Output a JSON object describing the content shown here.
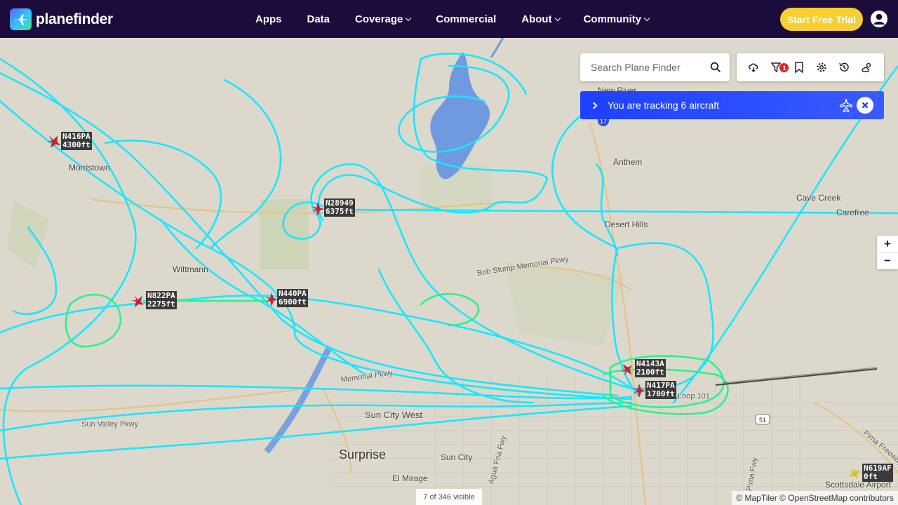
{
  "brand": {
    "name": "planefinder"
  },
  "nav": [
    {
      "label": "Apps",
      "dropdown": false
    },
    {
      "label": "Data",
      "dropdown": false
    },
    {
      "label": "Coverage",
      "dropdown": true
    },
    {
      "label": "Commercial",
      "dropdown": false
    },
    {
      "label": "About",
      "dropdown": true
    },
    {
      "label": "Community",
      "dropdown": true
    }
  ],
  "cta": {
    "label": "Start Free Trial",
    "color": "#f7cf2f"
  },
  "search": {
    "placeholder": "Search Plane Finder"
  },
  "toolbar": {
    "icons": [
      "weather-icon",
      "filter-icon",
      "bookmark-icon",
      "settings-icon",
      "history-icon",
      "cloud-sun-icon"
    ],
    "filter_badge": "1"
  },
  "tracking": {
    "text": "You are tracking 6 aircraft",
    "accent": "#1e41ff"
  },
  "zoom": {
    "in": "+",
    "out": "−"
  },
  "map": {
    "places": [
      {
        "name": "New River"
      },
      {
        "name": "Anthem"
      },
      {
        "name": "Morristown"
      },
      {
        "name": "Cave Creek"
      },
      {
        "name": "Carefree"
      },
      {
        "name": "Desert Hills"
      },
      {
        "name": "Wittmann"
      },
      {
        "name": "Bob Stump Memorial Pkwy"
      },
      {
        "name": "Memorial Pkwy"
      },
      {
        "name": "Sun City West"
      },
      {
        "name": "Sun Valley Pkwy"
      },
      {
        "name": "Surprise"
      },
      {
        "name": "Sun City"
      },
      {
        "name": "El Mirage"
      },
      {
        "name": "Agua Fria Fwy"
      },
      {
        "name": "Pima Freeway"
      },
      {
        "name": "Scottsdale Airport"
      },
      {
        "name": "Pima Fwy"
      },
      {
        "name": "Loop 101"
      }
    ],
    "route_shields": [
      "17",
      "51"
    ],
    "aircraft": [
      {
        "callsign": "N416PA",
        "altitude": "4300ft"
      },
      {
        "callsign": "N28949",
        "altitude": "6375ft"
      },
      {
        "callsign": "N822PA",
        "altitude": "2275ft"
      },
      {
        "callsign": "N440PA",
        "altitude": "6900ft"
      },
      {
        "callsign": "N4143A",
        "altitude": "2100ft"
      },
      {
        "callsign": "N417PA",
        "altitude": "1700ft"
      },
      {
        "callsign": "N619AF",
        "altitude": "0ft"
      }
    ],
    "track_color": "#19e6ff",
    "track_low_color": "#2ef08c"
  },
  "visible_count": "7 of 346 visible",
  "attribution": "© MapTiler © OpenStreetMap contributors"
}
